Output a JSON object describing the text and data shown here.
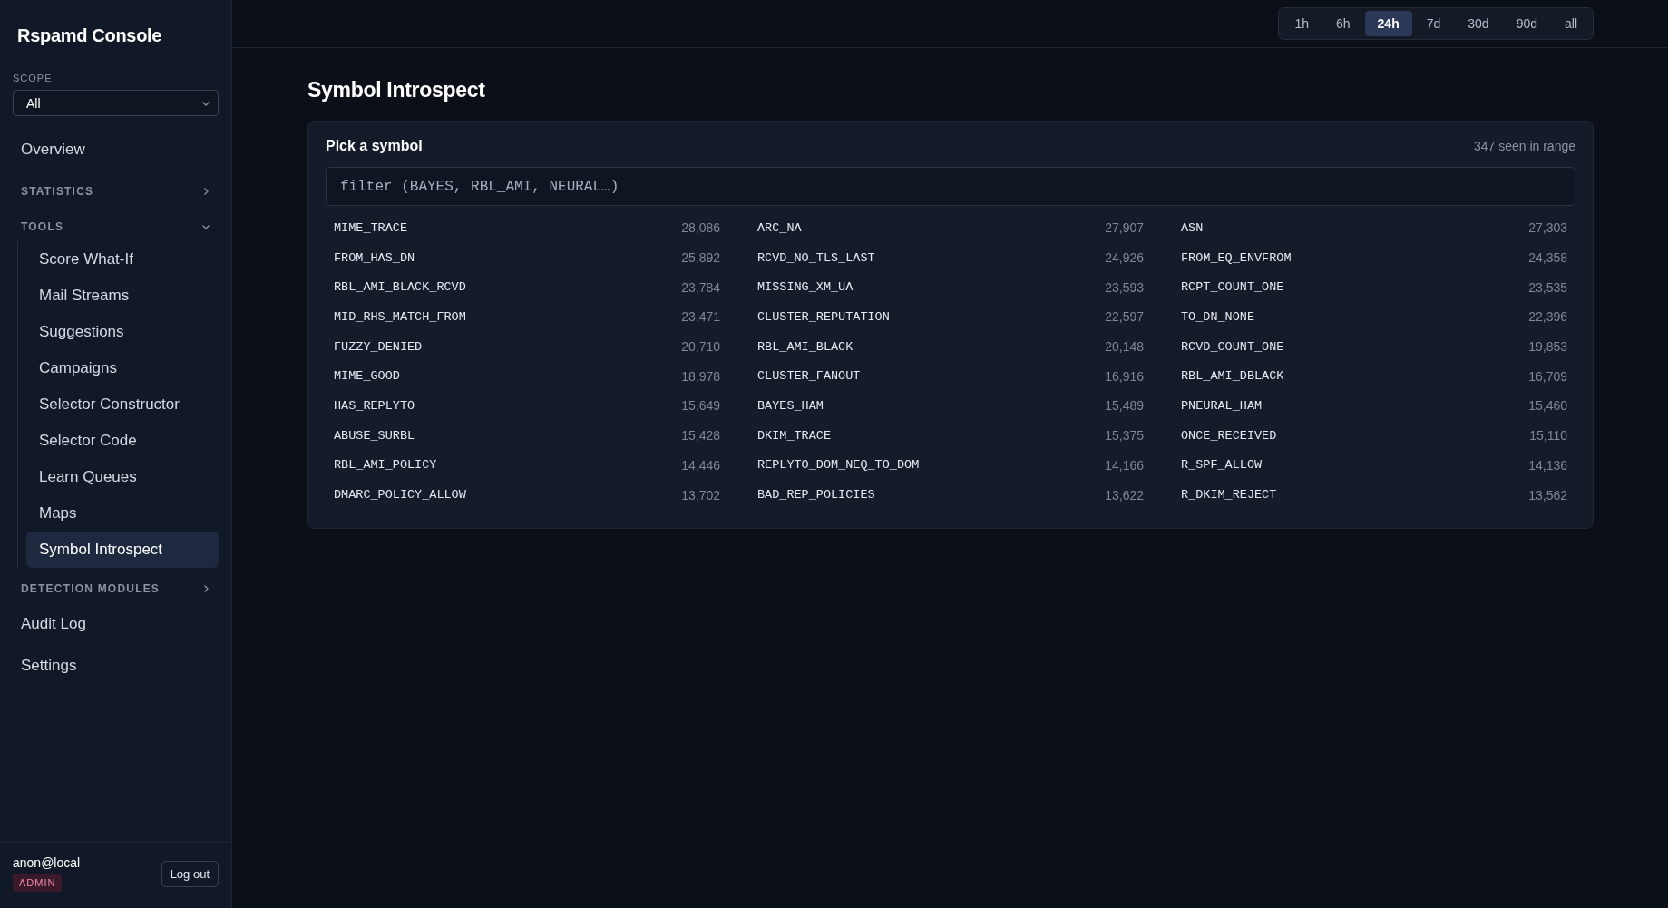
{
  "sidebar": {
    "title": "Rspamd Console",
    "scope": {
      "label": "SCOPE",
      "value": "All"
    },
    "nav": [
      {
        "kind": "link",
        "label": "Overview",
        "selected": false
      },
      {
        "kind": "section",
        "label": "STATISTICS",
        "expanded": false
      },
      {
        "kind": "section",
        "label": "TOOLS",
        "expanded": true,
        "children": [
          {
            "label": "Score What-If",
            "selected": false
          },
          {
            "label": "Mail Streams",
            "selected": false
          },
          {
            "label": "Suggestions",
            "selected": false
          },
          {
            "label": "Campaigns",
            "selected": false
          },
          {
            "label": "Selector Constructor",
            "selected": false
          },
          {
            "label": "Selector Code",
            "selected": false
          },
          {
            "label": "Learn Queues",
            "selected": false
          },
          {
            "label": "Maps",
            "selected": false
          },
          {
            "label": "Symbol Introspect",
            "selected": true
          }
        ]
      },
      {
        "kind": "section",
        "label": "DETECTION MODULES",
        "expanded": false
      },
      {
        "kind": "link",
        "label": "Audit Log",
        "selected": false
      },
      {
        "kind": "link",
        "label": "Settings",
        "selected": false
      }
    ],
    "user": {
      "name": "anon@local",
      "role": "ADMIN",
      "logout": "Log out"
    }
  },
  "time_range": [
    {
      "label": "1h",
      "selected": false
    },
    {
      "label": "6h",
      "selected": false
    },
    {
      "label": "24h",
      "selected": true
    },
    {
      "label": "7d",
      "selected": false
    },
    {
      "label": "30d",
      "selected": false
    },
    {
      "label": "90d",
      "selected": false
    },
    {
      "label": "all",
      "selected": false
    }
  ],
  "page_title": "Symbol Introspect",
  "card": {
    "title": "Pick a symbol",
    "count": "347 seen in range",
    "filter": {
      "placeholder": "filter (BAYES, RBL_AMI, NEURAL…)"
    },
    "symbols": [
      {
        "name": "MIME_TRACE",
        "count": "28,086"
      },
      {
        "name": "ARC_NA",
        "count": "27,907"
      },
      {
        "name": "ASN",
        "count": "27,303"
      },
      {
        "name": "FROM_HAS_DN",
        "count": "25,892"
      },
      {
        "name": "RCVD_NO_TLS_LAST",
        "count": "24,926"
      },
      {
        "name": "FROM_EQ_ENVFROM",
        "count": "24,358"
      },
      {
        "name": "RBL_AMI_BLACK_RCVD",
        "count": "23,784"
      },
      {
        "name": "MISSING_XM_UA",
        "count": "23,593"
      },
      {
        "name": "RCPT_COUNT_ONE",
        "count": "23,535"
      },
      {
        "name": "MID_RHS_MATCH_FROM",
        "count": "23,471"
      },
      {
        "name": "CLUSTER_REPUTATION",
        "count": "22,597"
      },
      {
        "name": "TO_DN_NONE",
        "count": "22,396"
      },
      {
        "name": "FUZZY_DENIED",
        "count": "20,710"
      },
      {
        "name": "RBL_AMI_BLACK",
        "count": "20,148"
      },
      {
        "name": "RCVD_COUNT_ONE",
        "count": "19,853"
      },
      {
        "name": "MIME_GOOD",
        "count": "18,978"
      },
      {
        "name": "CLUSTER_FANOUT",
        "count": "16,916"
      },
      {
        "name": "RBL_AMI_DBLACK",
        "count": "16,709"
      },
      {
        "name": "HAS_REPLYTO",
        "count": "15,649"
      },
      {
        "name": "BAYES_HAM",
        "count": "15,489"
      },
      {
        "name": "PNEURAL_HAM",
        "count": "15,460"
      },
      {
        "name": "ABUSE_SURBL",
        "count": "15,428"
      },
      {
        "name": "DKIM_TRACE",
        "count": "15,375"
      },
      {
        "name": "ONCE_RECEIVED",
        "count": "15,110"
      },
      {
        "name": "RBL_AMI_POLICY",
        "count": "14,446"
      },
      {
        "name": "REPLYTO_DOM_NEQ_TO_DOM",
        "count": "14,166"
      },
      {
        "name": "R_SPF_ALLOW",
        "count": "14,136"
      },
      {
        "name": "DMARC_POLICY_ALLOW",
        "count": "13,702"
      },
      {
        "name": "BAD_REP_POLICIES",
        "count": "13,622"
      },
      {
        "name": "R_DKIM_REJECT",
        "count": "13,562"
      }
    ]
  }
}
